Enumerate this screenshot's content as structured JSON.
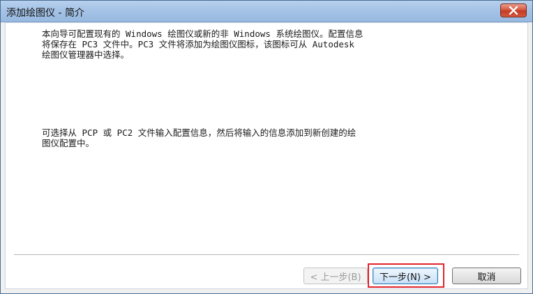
{
  "window": {
    "title": "添加绘图仪 - 简介"
  },
  "content": {
    "paragraph1": "本向导可配置现有的 Windows 绘图仪或新的非 Windows 系统绘图仪。配置信息\n将保存在 PC3 文件中。PC3 文件将添加为绘图仪图标，该图标可从 Autodesk\n绘图仪管理器中选择。",
    "paragraph2": "可选择从 PCP 或 PC2 文件输入配置信息，然后将输入的信息添加到新创建的绘\n图仪配置中。"
  },
  "buttons": {
    "back": "< 上一步(B)",
    "next": "下一步(N) >",
    "cancel": "取消"
  },
  "colors": {
    "titlebar": "#a5c3e6",
    "close_button": "#c23a23",
    "highlight_box": "#e0232a"
  },
  "icons": {
    "close": "close-icon"
  }
}
